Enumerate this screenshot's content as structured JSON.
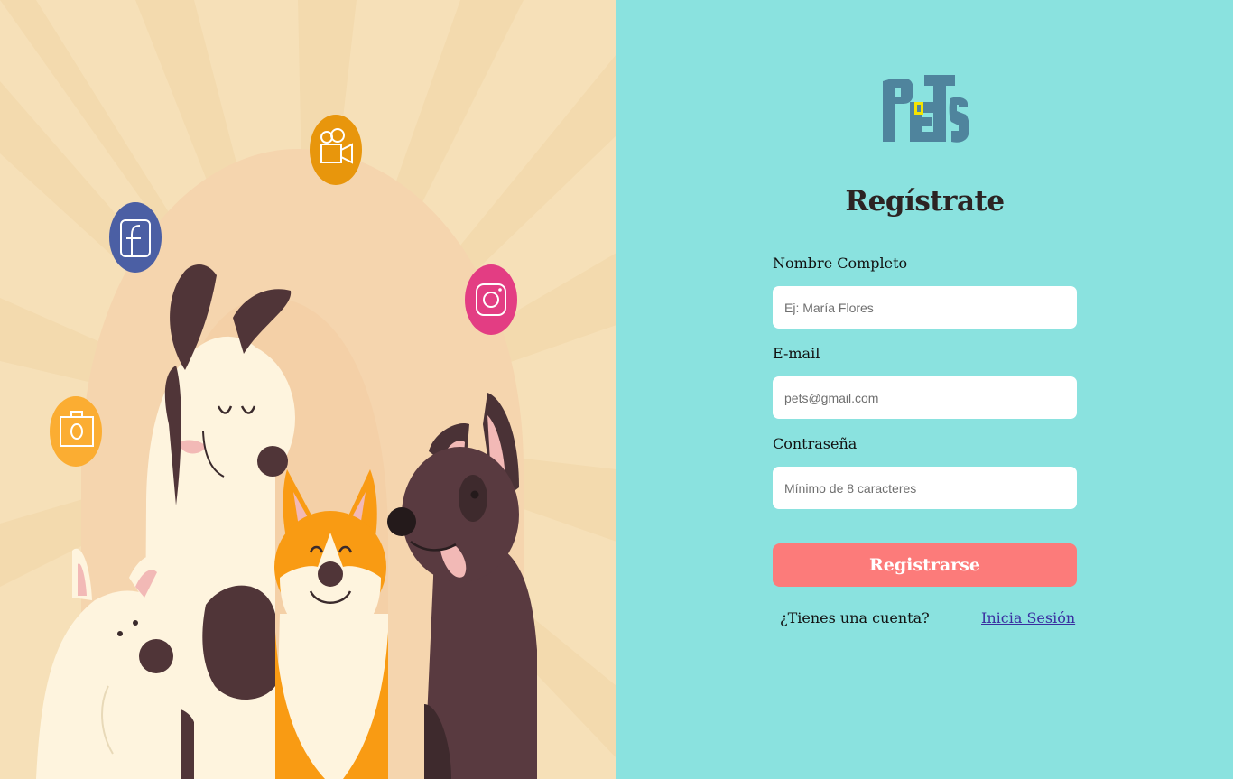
{
  "brand": {
    "logo_text": "PeTs"
  },
  "form": {
    "title": "Regístrate",
    "name_label": "Nombre Completo",
    "name_placeholder": "Ej: María Flores",
    "email_label": "E-mail",
    "email_placeholder": "pets@gmail.com",
    "password_label": "Contraseña",
    "password_placeholder": "Mínimo de 8 caracteres",
    "submit_label": "Registrarse",
    "account_question": "¿Tienes una cuenta?",
    "login_link": "Inicia Sesión"
  },
  "colors": {
    "left_background": "#f6e0b8",
    "right_background": "#8ae2df",
    "button": "#fc7b7a",
    "logo": "#4f849d",
    "title_text": "#2c2323",
    "link": "#3a2ea0"
  },
  "illustration": {
    "icons": [
      "video-camera-icon",
      "facebook-icon",
      "instagram-icon",
      "shopping-bag-icon"
    ],
    "characters": [
      "white-dog",
      "corgi-dog",
      "brown-dog",
      "fluffy-dog"
    ]
  }
}
